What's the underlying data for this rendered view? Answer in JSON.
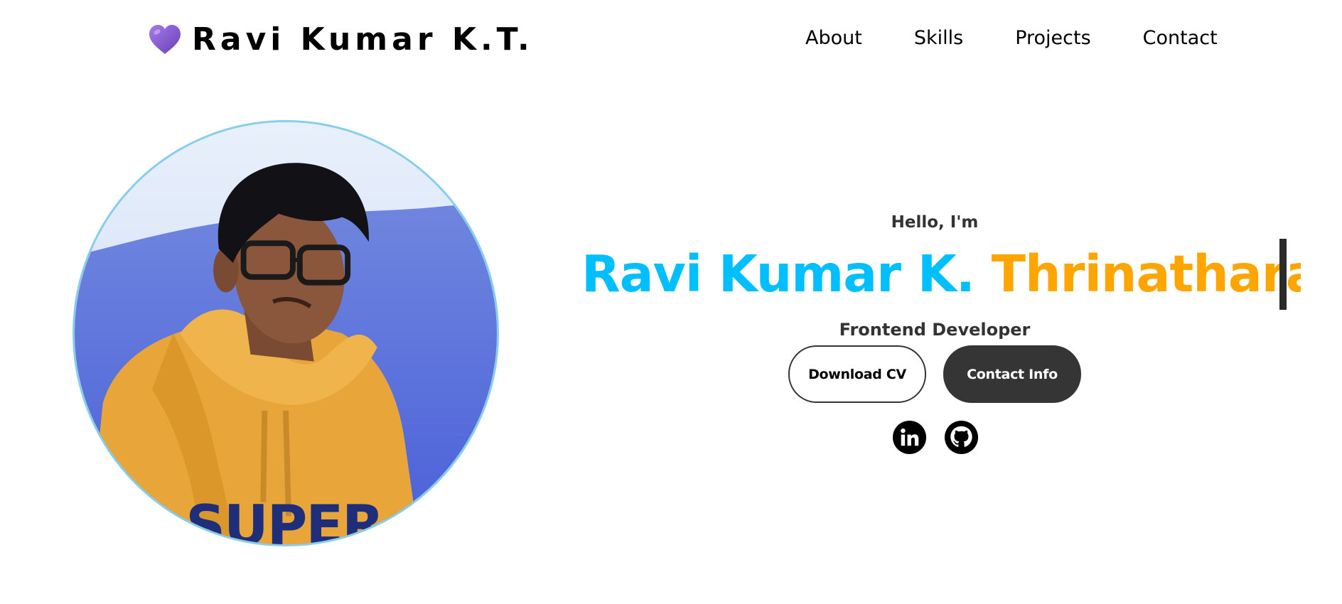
{
  "header": {
    "logo_icon": "purple-heart-icon",
    "logo_text": "Ravi Kumar K.T."
  },
  "nav": {
    "items": [
      {
        "label": "About"
      },
      {
        "label": "Skills"
      },
      {
        "label": "Projects"
      },
      {
        "label": "Contact"
      }
    ]
  },
  "hero": {
    "greeting": "Hello, I'm",
    "name_first": "Ravi Kumar K.",
    "name_last": "Thrinatharao",
    "role": "Frontend Developer",
    "buttons": {
      "download_cv": "Download CV",
      "contact_info": "Contact Info"
    },
    "socials": [
      {
        "icon": "linkedin-icon"
      },
      {
        "icon": "github-icon"
      }
    ]
  },
  "colors": {
    "name_first": "#00bfff",
    "name_last": "#ffa500",
    "photo_border": "#87ceeb",
    "button_dark": "#353535",
    "logo_heart": "#8a5cd0"
  }
}
